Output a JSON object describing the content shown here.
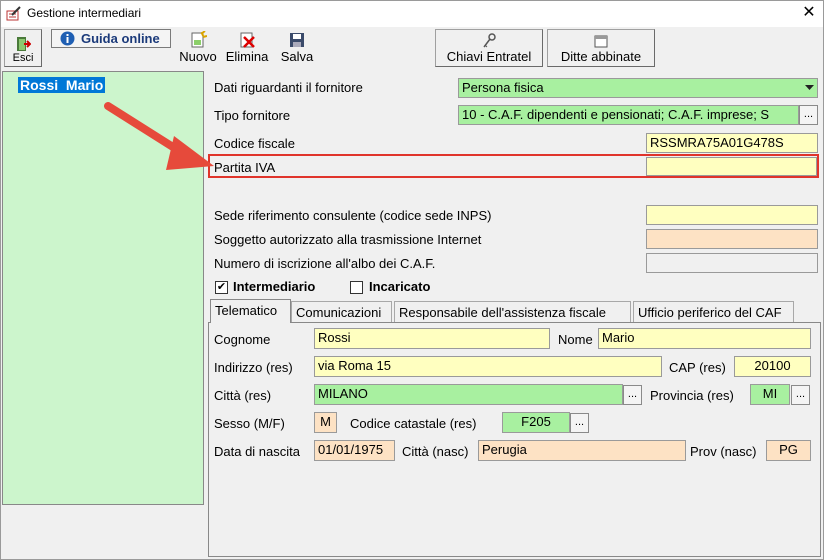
{
  "window": {
    "title": "Gestione intermediari",
    "close_glyph": "✕"
  },
  "toolbar": {
    "exit_label": "Esci",
    "guide_label": "Guida online",
    "new_label": "Nuovo",
    "delete_label": "Elimina",
    "save_label": "Salva",
    "keys_label": "Chiavi Entratel",
    "companies_label": "Ditte abbinate"
  },
  "list": {
    "items": [
      "Rossi  Mario"
    ],
    "selected_index": 0
  },
  "form": {
    "supplier_data_label": "Dati riguardanti il fornitore",
    "supplier_data_value": "Persona fisica",
    "supplier_type_label": "Tipo fornitore",
    "supplier_type_value": "10 - C.A.F. dipendenti e pensionati; C.A.F. imprese; S",
    "tax_code_label": "Codice fiscale",
    "tax_code_value": "RSSMRA75A01G478S",
    "vat_label": "Partita IVA",
    "vat_value": "",
    "inps_label": "Sede riferimento consulente (codice sede INPS)",
    "inps_value": "",
    "authorized_label": "Soggetto autorizzato alla trasmissione Internet",
    "authorized_value": "",
    "caf_reg_label": "Numero di iscrizione all'albo dei C.A.F.",
    "caf_reg_value": "",
    "intermediary_label": "Intermediario",
    "intermediary_checked": true,
    "appointee_label": "Incaricato",
    "appointee_checked": false
  },
  "tabs": [
    "Telematico",
    "Comunicazioni",
    "Responsabile dell'assistenza fiscale",
    "Ufficio periferico del CAF"
  ],
  "active_tab": "Telematico",
  "telematico": {
    "surname_label": "Cognome",
    "surname_value": "Rossi",
    "name_label": "Nome",
    "name_value": "Mario",
    "address_label": "Indirizzo (res)",
    "address_value": "via Roma 15",
    "cap_label": "CAP (res)",
    "cap_value": "20100",
    "city_label": "Città (res)",
    "city_value": "MILANO",
    "province_label": "Provincia (res)",
    "province_value": "MI",
    "sex_label": "Sesso (M/F)",
    "sex_value": "M",
    "cadastral_label": "Codice catastale (res)",
    "cadastral_value": "F205",
    "birth_date_label": "Data di nascita",
    "birth_date_value": "01/01/1975",
    "birth_city_label": "Città (nasc)",
    "birth_city_value": "Perugia",
    "birth_prov_label": "Prov (nasc)",
    "birth_prov_value": "PG"
  },
  "ellipsis": "...",
  "colors": {
    "highlight_red": "#e0342b",
    "arrow_red": "#e64a3b",
    "list_green": "#ccf5cc",
    "selection_blue": "#0078d7"
  },
  "icons": [
    "app-icon",
    "exit-icon",
    "info-icon",
    "new-icon",
    "delete-icon",
    "save-icon",
    "key-icon",
    "window-icon",
    "dropdown-arrow-icon",
    "annotation-arrow"
  ]
}
